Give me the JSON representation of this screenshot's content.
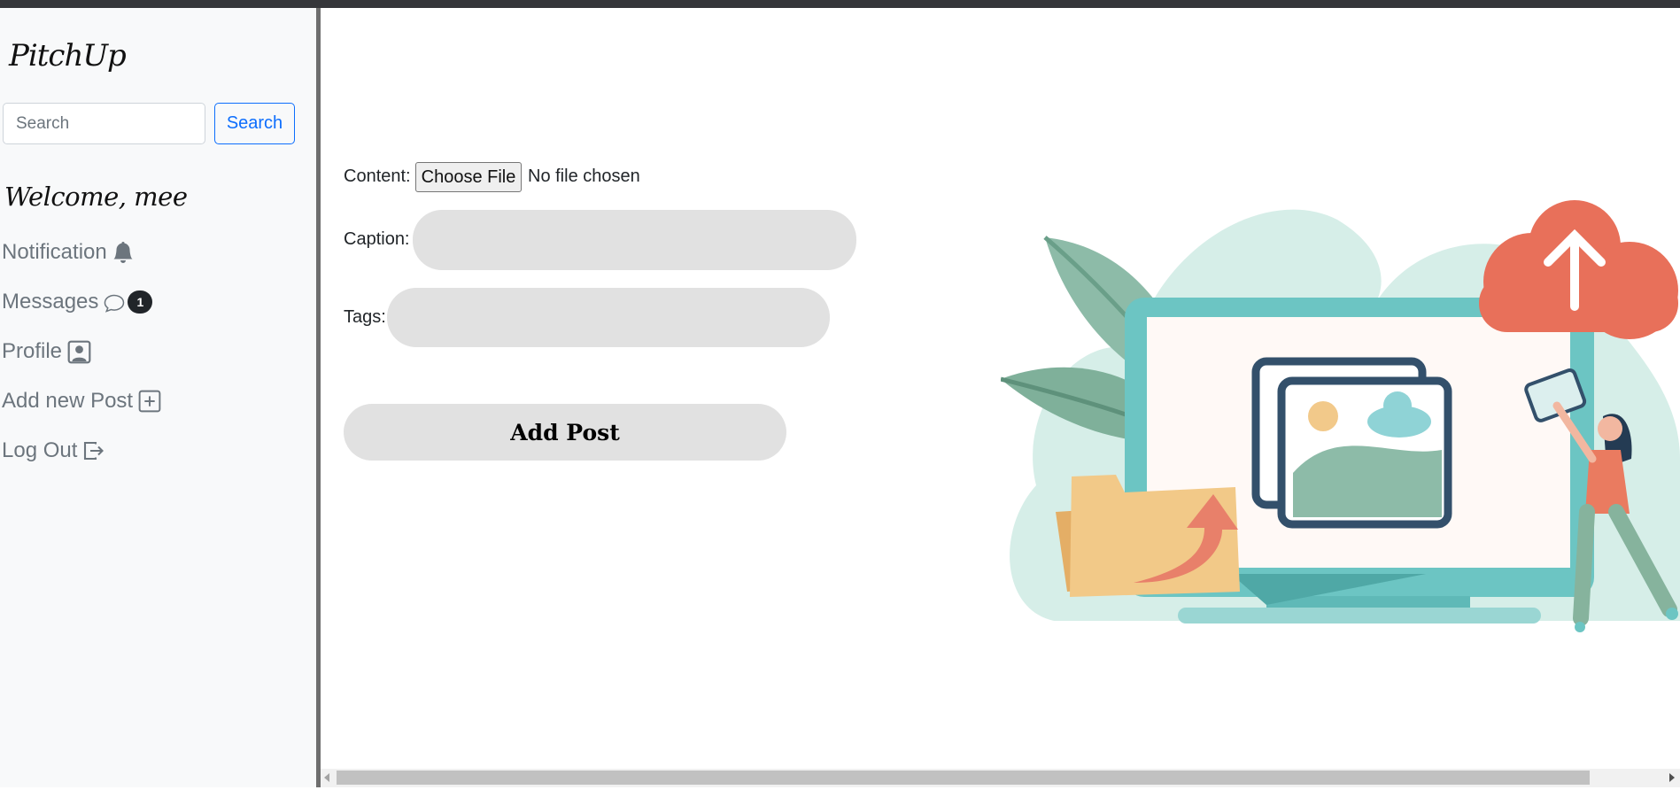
{
  "app": {
    "logo": "PitchUp"
  },
  "sidebar": {
    "search": {
      "placeholder": "Search",
      "button_label": "Search"
    },
    "welcome": "Welcome, mee",
    "items": [
      {
        "label": "Notification",
        "icon": "bell-icon"
      },
      {
        "label": "Messages",
        "icon": "chat-bubble-icon",
        "badge": "1"
      },
      {
        "label": "Profile",
        "icon": "person-square-icon"
      },
      {
        "label": "Add new Post",
        "icon": "plus-square-icon"
      },
      {
        "label": "Log Out",
        "icon": "box-arrow-right-icon"
      }
    ]
  },
  "form": {
    "content_label": "Content:",
    "file_button": "Choose File",
    "file_status": "No file chosen",
    "caption_label": "Caption:",
    "caption_value": "",
    "tags_label": "Tags:",
    "tags_value": "",
    "submit_label": "Add Post"
  },
  "colors": {
    "sidebar_bg": "#f8f9fa",
    "accent": "#0d6efd",
    "input_bg": "#e1e1e1",
    "teal": "#6cc5c3",
    "coral": "#e8705a"
  }
}
